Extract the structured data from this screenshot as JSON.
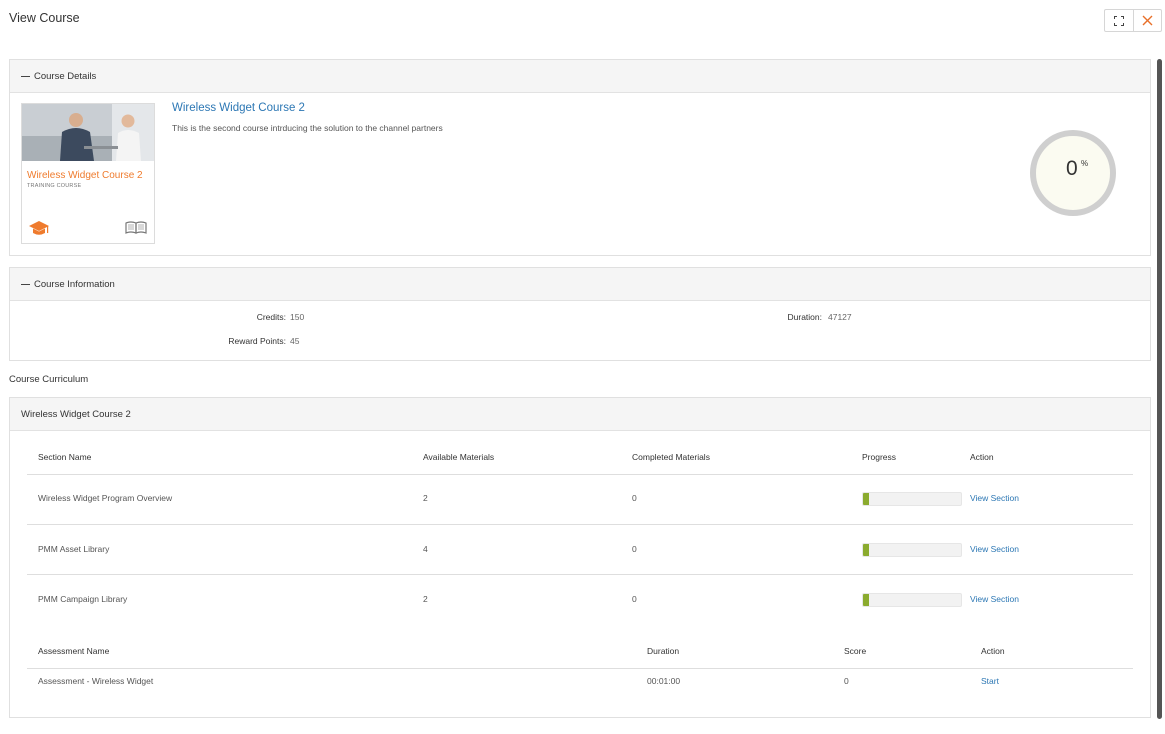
{
  "window": {
    "title": "View Course",
    "controls": [
      {
        "icon": "expand-icon"
      },
      {
        "icon": "close-icon",
        "color": "#e8702a"
      }
    ]
  },
  "course_details": {
    "header": "Course Details",
    "thumbnail": {
      "title": "Wireless Widget Course 2",
      "subtitle": "TRAINING COURSE",
      "icons": [
        "graduation-cap-icon",
        "book-icon"
      ]
    },
    "name": "Wireless Widget Course 2",
    "description": "This is the second course intrducing the solution to the channel partners",
    "progress": {
      "value": "0",
      "unit": "%"
    }
  },
  "course_information": {
    "header": "Course Information",
    "credits_label": "Credits:",
    "credits_value": "150",
    "reward_label": "Reward Points:",
    "reward_value": "45",
    "duration_label": "Duration:",
    "duration_value": "47127"
  },
  "curriculum": {
    "label": "Course Curriculum",
    "panel_title": "Wireless Widget Course 2",
    "sections_table": {
      "headers": [
        "Section Name",
        "Available Materials",
        "Completed Materials",
        "Progress",
        "Action"
      ],
      "rows": [
        {
          "name": "Wireless Widget Program Overview",
          "available": "2",
          "completed": "0",
          "progress_pct": 0,
          "progress_label": "0%",
          "action": "View Section"
        },
        {
          "name": "PMM Asset Library",
          "available": "4",
          "completed": "0",
          "progress_pct": 0,
          "progress_label": "0%",
          "action": "View Section"
        },
        {
          "name": "PMM Campaign Library",
          "available": "2",
          "completed": "0",
          "progress_pct": 0,
          "progress_label": "0%",
          "action": "View Section"
        }
      ]
    },
    "assessment_table": {
      "headers": [
        "Assessment Name",
        "Duration",
        "Score",
        "Action"
      ],
      "rows": [
        {
          "name": "Assessment - Wireless Widget",
          "duration": "00:01:00",
          "score": "0",
          "action": "Start"
        }
      ]
    }
  },
  "colors": {
    "accent_link": "#2c77b4",
    "accent_orange": "#ef7b2d",
    "progress_fill": "#8bab2e"
  }
}
